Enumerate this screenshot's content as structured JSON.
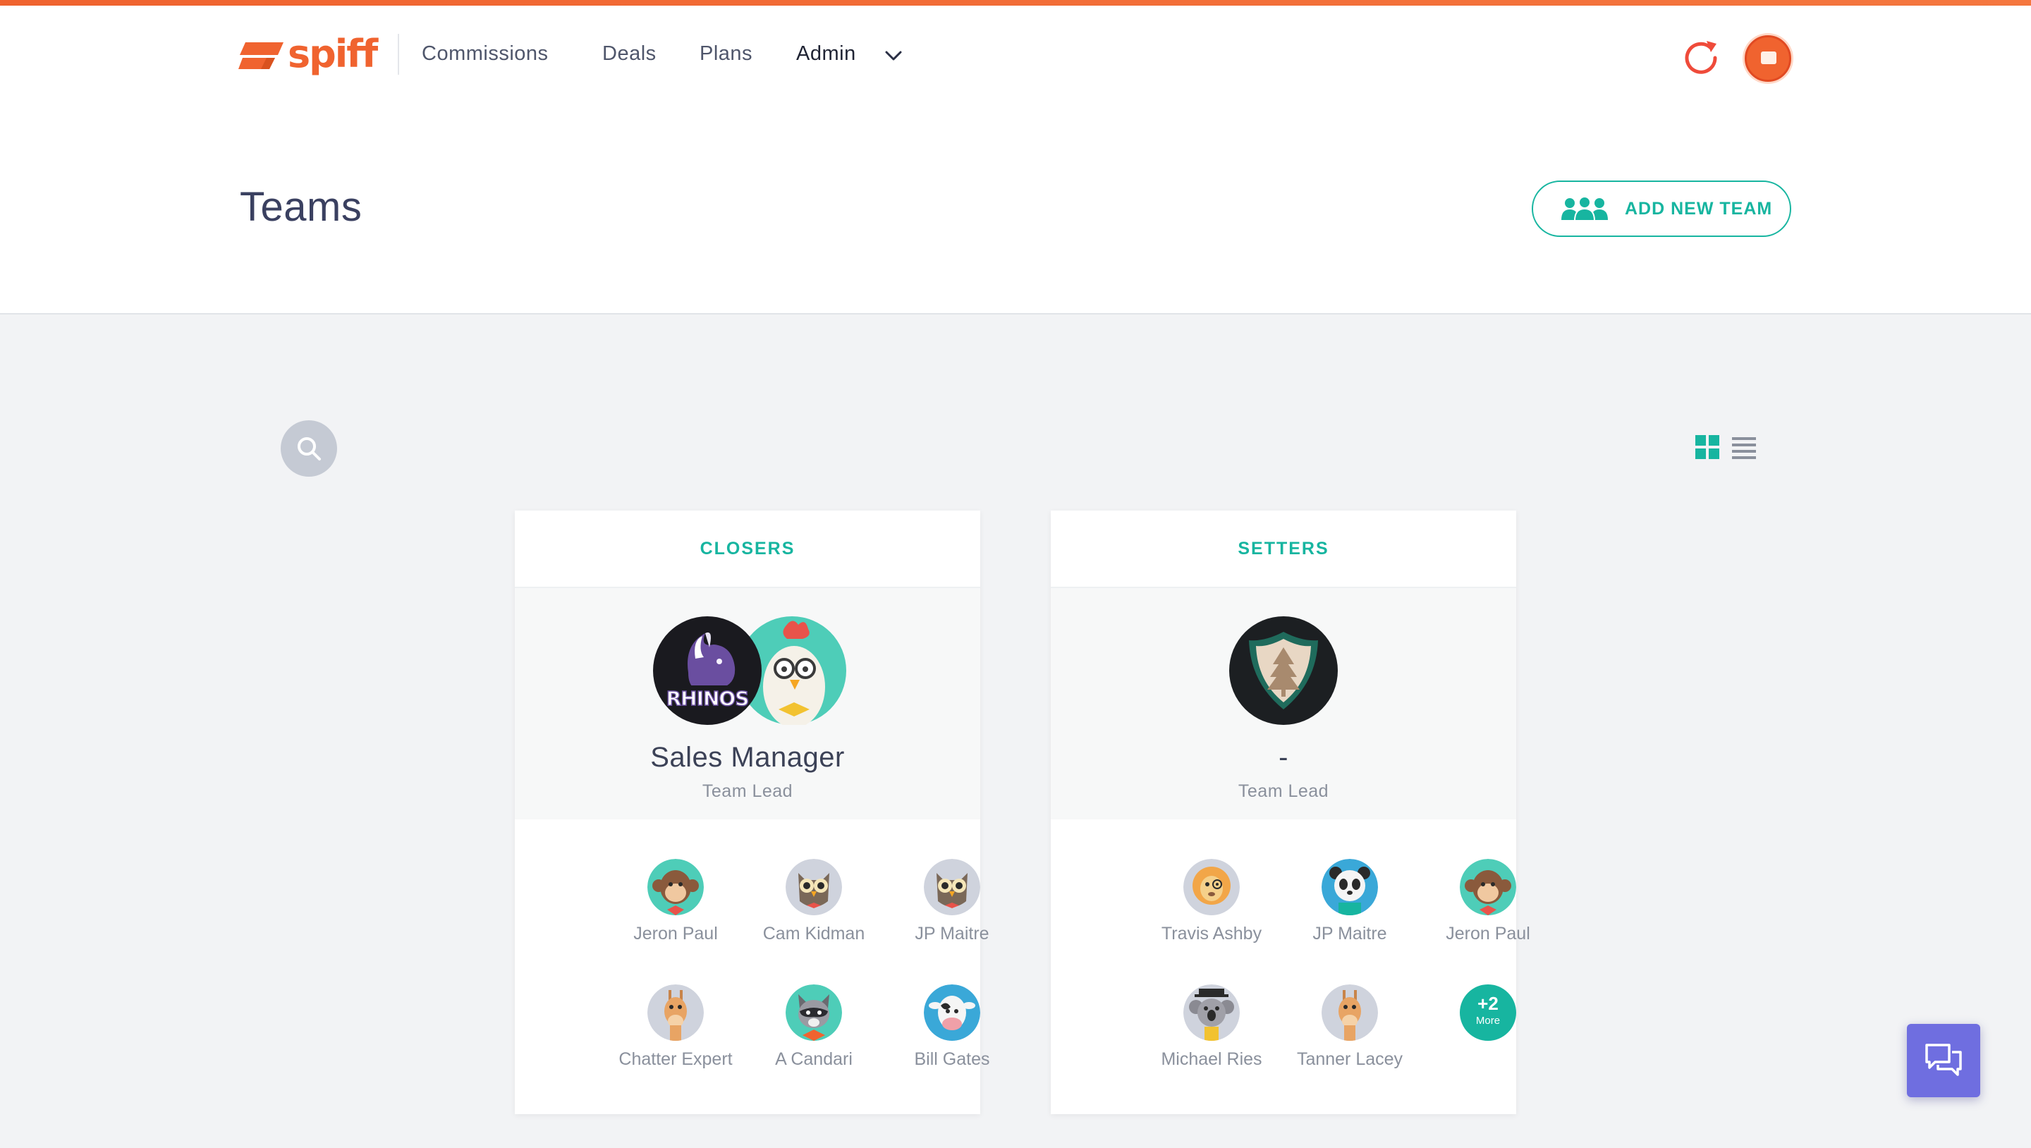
{
  "brand": {
    "logo_text": "spiff",
    "accent_color": "#f0632f",
    "teal_color": "#17b5a0"
  },
  "nav": {
    "items": [
      {
        "label": "Commissions"
      },
      {
        "label": "Deals"
      },
      {
        "label": "Plans"
      },
      {
        "label": "Admin"
      }
    ],
    "active": "Admin"
  },
  "page": {
    "title": "Teams",
    "add_button_label": "ADD NEW TEAM"
  },
  "view_toggle": {
    "selected": "grid"
  },
  "teams": [
    {
      "name": "CLOSERS",
      "lead": {
        "name": "Sales Manager",
        "role": "Team Lead",
        "avatars": [
          "rhinos-logo",
          "rooster-avatar"
        ]
      },
      "members": [
        {
          "name": "Jeron Paul",
          "avatar": "monkey-avatar"
        },
        {
          "name": "Cam Kidman",
          "avatar": "owl-avatar"
        },
        {
          "name": "JP Maitre",
          "avatar": "owl-avatar"
        },
        {
          "name": "Chatter Expert",
          "avatar": "giraffe-avatar"
        },
        {
          "name": "A Candari",
          "avatar": "raccoon-avatar"
        },
        {
          "name": "Bill Gates",
          "avatar": "cow-avatar"
        }
      ]
    },
    {
      "name": "SETTERS",
      "lead": {
        "name": "-",
        "role": "Team Lead",
        "avatars": [
          "shield-logo"
        ]
      },
      "members": [
        {
          "name": "Travis Ashby",
          "avatar": "lion-avatar"
        },
        {
          "name": "JP Maitre",
          "avatar": "panda-avatar"
        },
        {
          "name": "Jeron Paul",
          "avatar": "monkey-avatar"
        },
        {
          "name": "Michael Ries",
          "avatar": "koala-avatar"
        },
        {
          "name": "Tanner Lacey",
          "avatar": "giraffe-avatar"
        }
      ],
      "more": {
        "count": "+2",
        "label": "More"
      }
    }
  ]
}
